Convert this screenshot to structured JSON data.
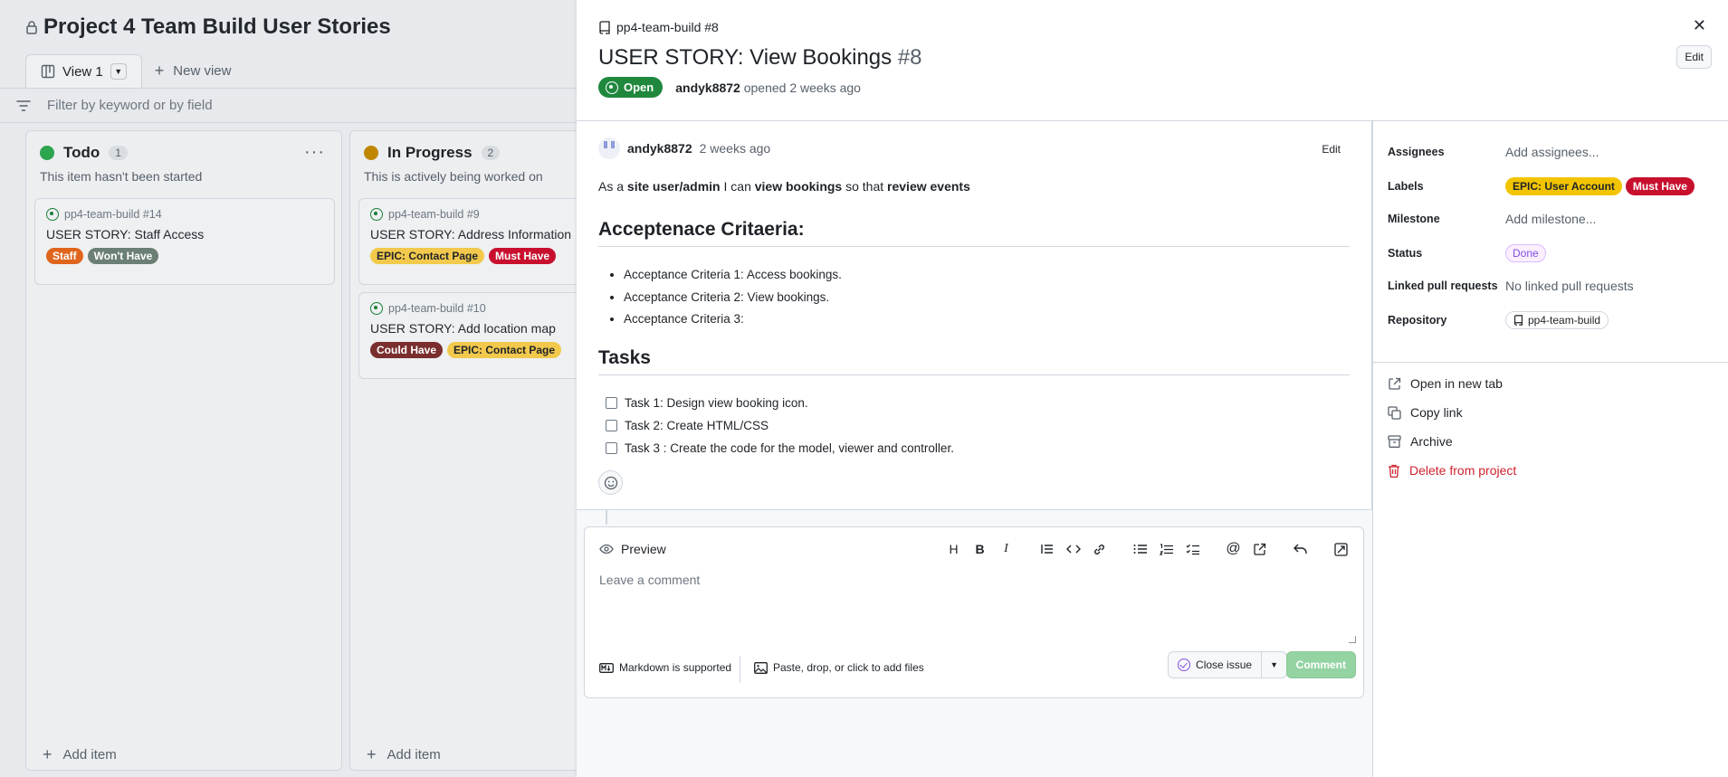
{
  "board": {
    "title": "Project 4 Team Build User Stories",
    "views": [
      {
        "label": "View 1"
      }
    ],
    "new_view_label": "New view",
    "filter_placeholder": "Filter by keyword or by field",
    "columns": [
      {
        "name": "Todo",
        "count": "1",
        "color": "#2da44e",
        "description": "This item hasn't been started",
        "cards": [
          {
            "repo": "pp4-team-build #14",
            "title": "USER STORY: Staff Access",
            "labels": [
              {
                "text": "Staff",
                "color": "#e0651c"
              },
              {
                "text": "Won't Have",
                "color": "#6b7f74"
              }
            ]
          }
        ],
        "add_label": "Add item"
      },
      {
        "name": "In Progress",
        "count": "2",
        "color": "#bf8700",
        "description": "This is actively being worked on",
        "cards": [
          {
            "repo": "pp4-team-build #9",
            "title": "USER STORY: Address Information",
            "labels": [
              {
                "text": "EPIC: Contact Page",
                "color": "#f2c94c",
                "text_color": "#1f2328"
              },
              {
                "text": "Must Have",
                "color": "#c8102e"
              }
            ]
          },
          {
            "repo": "pp4-team-build #10",
            "title": "USER STORY: Add location map",
            "labels": [
              {
                "text": "Could Have",
                "color": "#7a2e2e"
              },
              {
                "text": "EPIC: Contact Page",
                "color": "#f2c94c",
                "text_color": "#1f2328"
              }
            ]
          }
        ],
        "add_label": "Add item"
      }
    ]
  },
  "issue": {
    "repo_crumb": "pp4-team-build #8",
    "title": "USER STORY: View Bookings",
    "number": "#8",
    "edit_label": "Edit",
    "state": "Open",
    "author": "andyk8872",
    "opened_text": "opened 2 weeks ago",
    "comment": {
      "author": "andyk8872",
      "when": "2 weeks ago",
      "edit_label": "Edit",
      "story_parts": [
        "As a ",
        "site user/admin",
        " I can ",
        "view bookings",
        " so that ",
        "review events"
      ],
      "acceptance_heading": "Acceptenace Critaeria:",
      "acceptance_items": [
        "Acceptance Criteria 1: Access bookings.",
        "Acceptance Criteria 2: View bookings.",
        "Acceptance Criteria 3:"
      ],
      "tasks_heading": "Tasks",
      "tasks": [
        "Task 1: Design view booking icon.",
        "Task 2: Create HTML/CSS",
        "Task 3 : Create the code for the model, viewer and controller."
      ]
    },
    "composer": {
      "preview_label": "Preview",
      "placeholder": "Leave a comment",
      "markdown_label": "Markdown is supported",
      "paste_label": "Paste, drop, or click to add files",
      "close_issue_label": "Close issue",
      "comment_label": "Comment",
      "toolbar_icons": [
        "heading-icon",
        "bold-icon",
        "italic-icon",
        "quote-icon",
        "code-icon",
        "link-icon",
        "unordered-list-icon",
        "ordered-list-icon",
        "task-list-icon",
        "mention-icon",
        "cross-reference-icon",
        "reply-icon",
        "fullscreen-icon"
      ]
    }
  },
  "sidebar": {
    "fields": {
      "assignees": {
        "label": "Assignees",
        "value": "Add assignees..."
      },
      "labels": {
        "label": "Labels",
        "items": [
          {
            "text": "EPIC: User Account",
            "color": "#f2c400",
            "text_color": "#1f2328"
          },
          {
            "text": "Must Have",
            "color": "#c8102e",
            "text_color": "#ffffff"
          }
        ]
      },
      "milestone": {
        "label": "Milestone",
        "value": "Add milestone..."
      },
      "status": {
        "label": "Status",
        "value": "Done"
      },
      "linked_prs": {
        "label": "Linked pull requests",
        "value": "No linked pull requests"
      },
      "repository": {
        "label": "Repository",
        "value": "pp4-team-build"
      }
    },
    "actions": {
      "open_new_tab": "Open in new tab",
      "copy_link": "Copy link",
      "archive": "Archive",
      "delete": "Delete from project"
    }
  }
}
